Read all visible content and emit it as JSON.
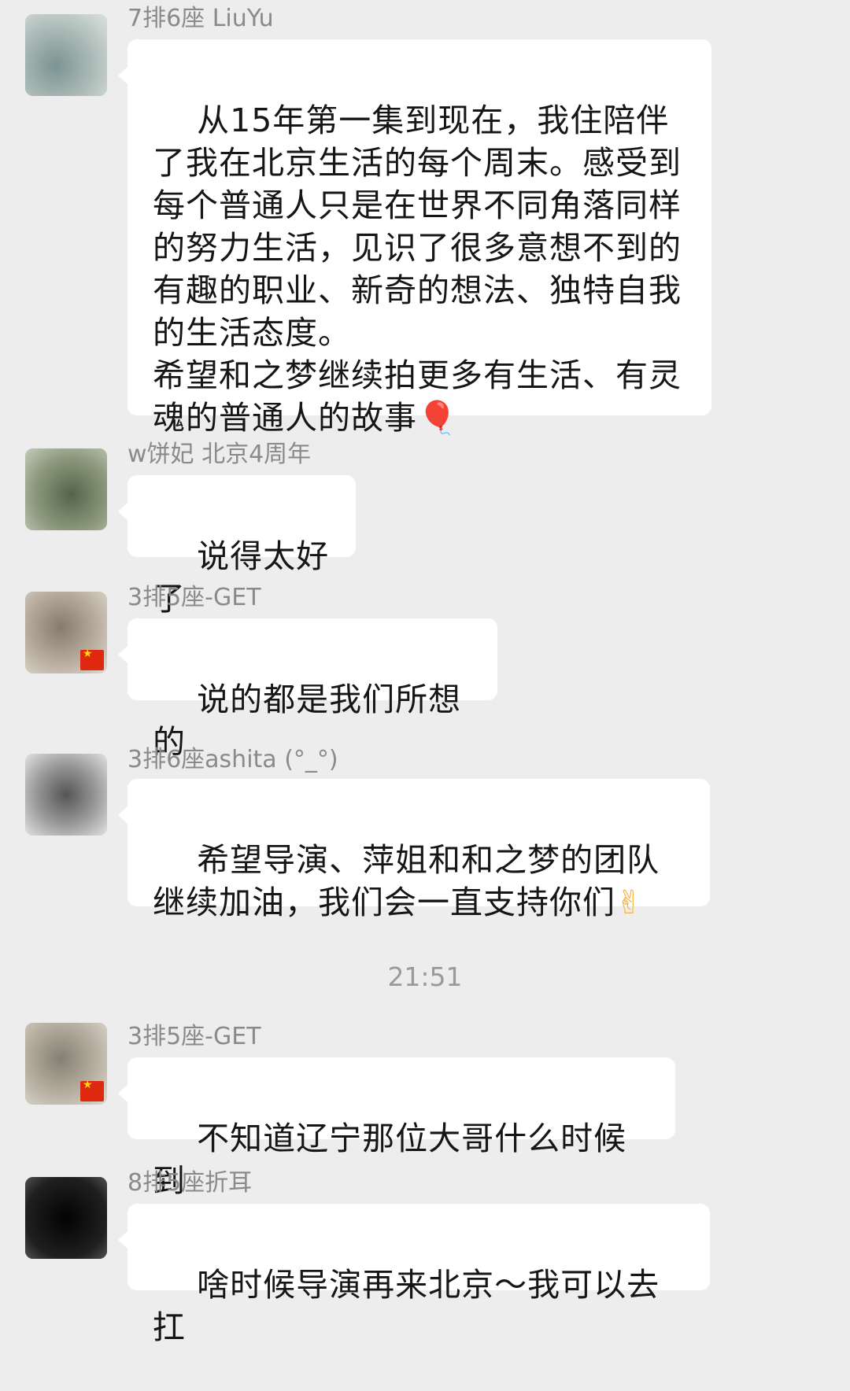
{
  "messages": [
    {
      "sender": "7排6座 LiuYu",
      "text": "从15年第一集到现在，我住陪伴了我在北京生活的每个周末。感受到每个普通人只是在世界不同角落同样的努力生活，见识了很多意想不到的有趣的职业、新奇的想法、独特自我的生活态度。\n希望和之梦继续拍更多有生活、有灵魂的普通人的故事",
      "emoji": "🎈"
    },
    {
      "sender": "w饼妃 北京4周年",
      "text": "说得太好了",
      "emoji": ""
    },
    {
      "sender": "3排5座-GET",
      "text": "说的都是我们所想的",
      "emoji": ""
    },
    {
      "sender": "3排6座ashita (°_°)",
      "text": "希望导演、萍姐和和之梦的团队继续加油，我们会一直支持你们",
      "emoji": "✌"
    },
    {
      "sender": "3排5座-GET",
      "text": "不知道辽宁那位大哥什么时候到",
      "emoji": ""
    },
    {
      "sender": "8排5座折耳",
      "text": "啥时候导演再来北京～我可以去扛",
      "emoji": ""
    }
  ],
  "timestamp": "21:51",
  "colors": {
    "background": "#ededed",
    "bubble": "#ffffff",
    "sender_text": "#8a8a8a",
    "message_text": "#161616"
  }
}
